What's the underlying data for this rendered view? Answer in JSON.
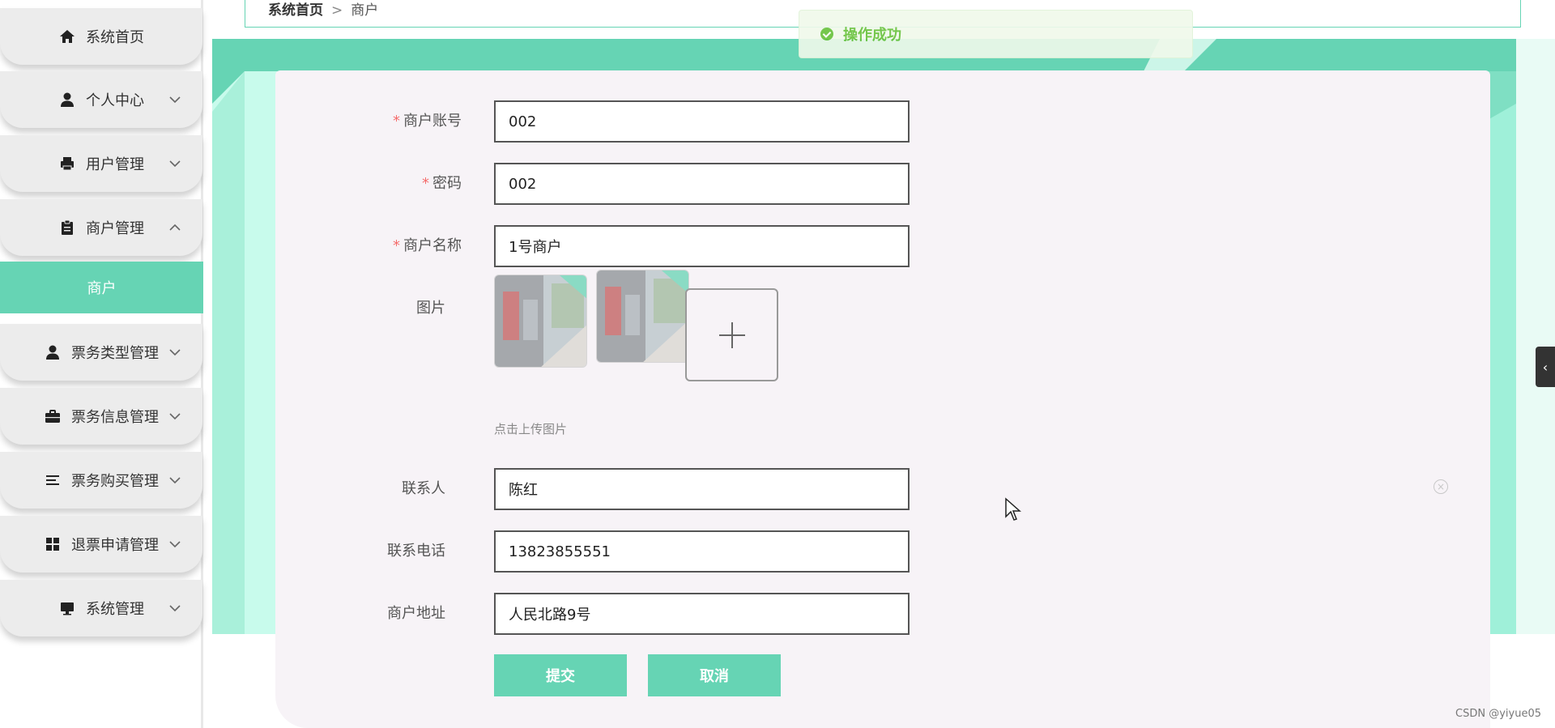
{
  "sidebar": {
    "items": [
      {
        "label": "系统首页",
        "icon": "home-icon",
        "has_arrow": false,
        "expanded": false
      },
      {
        "label": "个人中心",
        "icon": "user-icon",
        "has_arrow": true,
        "expanded": false
      },
      {
        "label": "用户管理",
        "icon": "printer-icon",
        "has_arrow": true,
        "expanded": false
      },
      {
        "label": "商户管理",
        "icon": "clipboard-icon",
        "has_arrow": true,
        "expanded": true
      },
      {
        "label": "票务类型管理",
        "icon": "user-icon",
        "has_arrow": true,
        "expanded": false
      },
      {
        "label": "票务信息管理",
        "icon": "briefcase-icon",
        "has_arrow": true,
        "expanded": false
      },
      {
        "label": "票务购买管理",
        "icon": "list-icon",
        "has_arrow": true,
        "expanded": false
      },
      {
        "label": "退票申请管理",
        "icon": "grid-icon",
        "has_arrow": true,
        "expanded": false
      },
      {
        "label": "系统管理",
        "icon": "monitor-icon",
        "has_arrow": true,
        "expanded": false
      }
    ],
    "active_subitem": "商户"
  },
  "breadcrumb": {
    "home": "系统首页",
    "separator": ">",
    "current": "商户"
  },
  "toast": {
    "message": "操作成功",
    "type": "success"
  },
  "form": {
    "account": {
      "label": "商户账号",
      "required": true,
      "value": "002"
    },
    "password": {
      "label": "密码",
      "required": true,
      "value": "002"
    },
    "name": {
      "label": "商户名称",
      "required": true,
      "value": "1号商户"
    },
    "images": {
      "label": "图片",
      "hint": "点击上传图片",
      "count": 2
    },
    "contact": {
      "label": "联系人",
      "required": false,
      "value": "陈红"
    },
    "phone": {
      "label": "联系电话",
      "required": false,
      "value": "13823855551"
    },
    "address": {
      "label": "商户地址",
      "required": false,
      "value": "人民北路9号"
    },
    "submit_label": "提交",
    "cancel_label": "取消"
  },
  "colors": {
    "accent": "#66d4b4",
    "success": "#67c23a",
    "required": "#f56c6c"
  },
  "watermark": "CSDN @yiyue05"
}
